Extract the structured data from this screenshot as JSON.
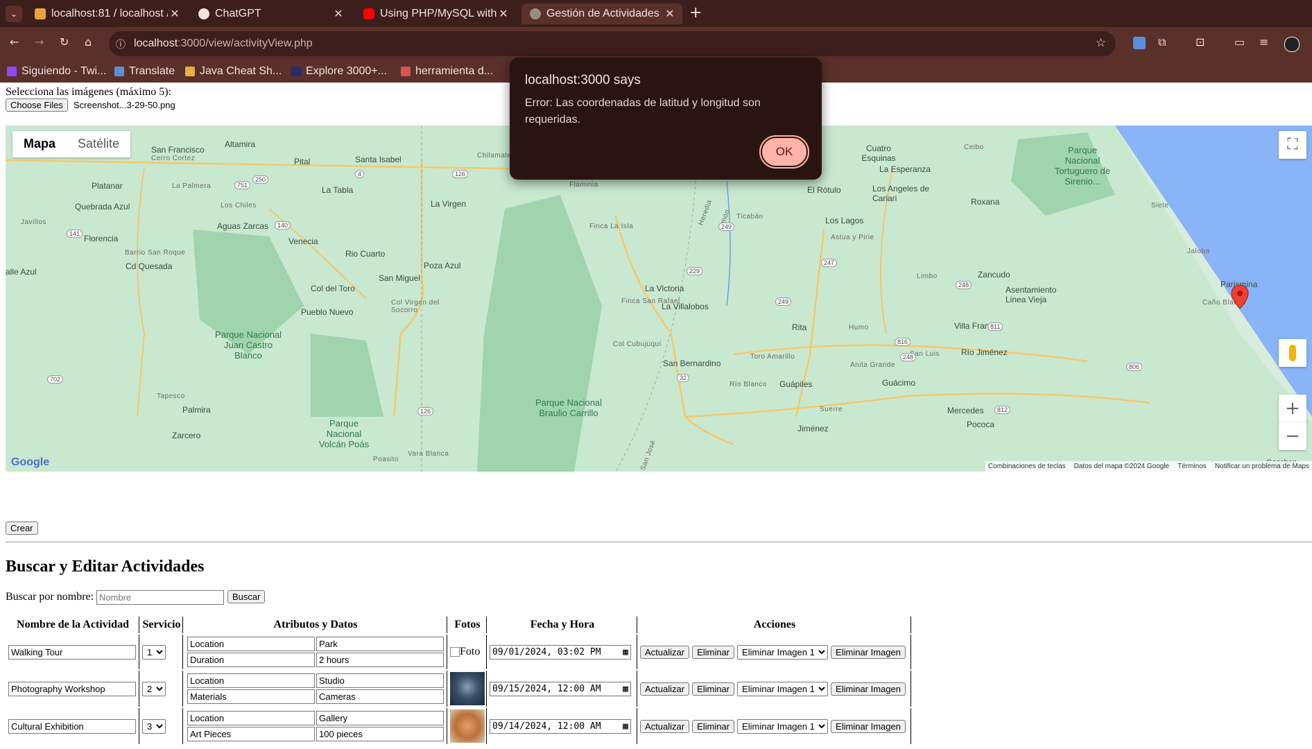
{
  "browser": {
    "tabs": [
      {
        "title": "localhost:81 / localhost /",
        "favicon": "phpmyadmin-icon"
      },
      {
        "title": "ChatGPT",
        "favicon": "chatgpt-icon"
      },
      {
        "title": "Using PHP/MySQL with G",
        "favicon": "youtube-icon"
      },
      {
        "title": "Gestión de Actividades",
        "favicon": "globe-icon",
        "active": true
      }
    ],
    "new_tab": "+",
    "url_host": "localhost",
    "url_rest": ":3000/view/activityView.php",
    "bookmarks": [
      "Siguiendo - Twi...",
      "Translate",
      "Java Cheat Sh...",
      "Explore 3000+...",
      "herramienta d..."
    ]
  },
  "form": {
    "images_label": "Selecciona las imágenes (máximo 5):",
    "choose_files": "Choose Files",
    "file_name": "Screenshot...3-29-50.png",
    "create_button": "Crear"
  },
  "map": {
    "type_map": "Mapa",
    "type_satellite": "Satélite",
    "logo": "Google",
    "attribution": [
      "Combinaciones de teclas",
      "Datos del mapa ©2024 Google",
      "Términos",
      "Notificar un problema de Maps"
    ],
    "places": [
      "San Francisco",
      "Altamira",
      "Pital",
      "Santa Isabel",
      "Platanar",
      "La Palmera",
      "La Tabla",
      "La Virgen",
      "Quebrada Azul",
      "Los Chiles",
      "Aguas Zarcas",
      "Venecia",
      "Florencia",
      "Barrio San Roque",
      "Cd Quesada",
      "Javillos",
      "alle Azul",
      "Rio Cuarto",
      "Poza Azul",
      "San Miguel",
      "Col del Toro",
      "Pueblo Nuevo",
      "Col Virgen del Socorro",
      "Parque Nacional Juan Castro Blanco",
      "Tapesco",
      "Palmira",
      "Zarcero",
      "Parque Nacional Volcán Poás",
      "Poasito",
      "Vara Blanca",
      "Parque Nacional Braulio Carrillo",
      "Flaminia",
      "Heredia",
      "Limón",
      "Finca La Isla",
      "Ticabán",
      "La Victoria",
      "Finca San Rafael",
      "La Villalobos",
      "Col Cubujuquí",
      "San Bernardino",
      "Toro Amarillo",
      "Rita",
      "Río Blanco",
      "Guápiles",
      "Humo",
      "Anita Grande",
      "Villa Franca",
      "Zancudo",
      "Asentamiento Linea Vieja",
      "Limbo",
      "Guácimo",
      "Parismina",
      "Río Jiménez",
      "San Luis",
      "Suerre",
      "Mercedes",
      "Pococa",
      "Jiménez",
      "Cuatro Esquinas",
      "La Esperanza",
      "Ceibo",
      "El Rótulo",
      "Los Angeles de Cariari",
      "Roxana",
      "Los Lagos",
      "Astua y Pirie",
      "Jaloba",
      "Siete",
      "Caño Blanco",
      "Parque Nacional Tortuguero de Sirenio...",
      "Goschen",
      "Parismina",
      "San José",
      "Cerro Cortez",
      "Chilamate"
    ],
    "routes": [
      "141",
      "751",
      "250",
      "4",
      "126",
      "140",
      "229",
      "249",
      "247",
      "248",
      "816",
      "811",
      "248",
      "806",
      "812",
      "702",
      "32",
      "126",
      "249"
    ]
  },
  "dialog": {
    "title": "localhost:3000 says",
    "message": "Error: Las coordenadas de latitud y longitud son requeridas.",
    "ok": "OK"
  },
  "search": {
    "heading": "Buscar y Editar Actividades",
    "label": "Buscar por nombre:",
    "placeholder": "Nombre",
    "button": "Buscar"
  },
  "table": {
    "headers": [
      "Nombre de la Actividad",
      "Servicio",
      "Atributos y Datos",
      "Fotos",
      "Fecha y Hora",
      "Acciones"
    ],
    "rows": [
      {
        "name": "Walking Tour",
        "service": "1",
        "attrs": [
          [
            "Location",
            "Park"
          ],
          [
            "Duration",
            "2 hours"
          ]
        ],
        "photo": "Foto",
        "datetime": "09/01/2024, 03:02 PM",
        "delete_image_select": "Eliminar Imagen 1"
      },
      {
        "name": "Photography Workshop",
        "service": "2",
        "attrs": [
          [
            "Location",
            "Studio"
          ],
          [
            "Materials",
            "Cameras"
          ]
        ],
        "photo": "",
        "datetime": "09/15/2024, 12:00 AM",
        "delete_image_select": "Eliminar Imagen 1"
      },
      {
        "name": "Cultural Exhibition",
        "service": "3",
        "attrs": [
          [
            "Location",
            "Gallery"
          ],
          [
            "Art Pieces",
            "100 pieces"
          ]
        ],
        "photo": "",
        "datetime": "09/14/2024, 12:00 AM",
        "delete_image_select": "Eliminar Imagen 1"
      }
    ],
    "actions": {
      "update": "Actualizar",
      "delete": "Eliminar",
      "delete_image": "Eliminar Imagen"
    }
  }
}
